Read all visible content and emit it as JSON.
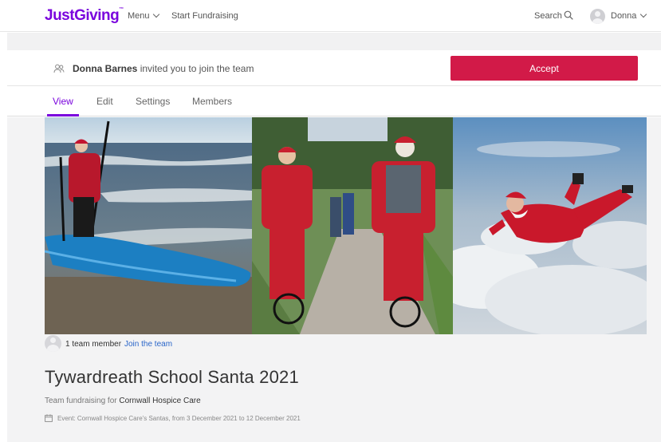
{
  "nav": {
    "logo": "JustGiving",
    "logo_mark": "™",
    "menu_label": "Menu",
    "start_fundraising": "Start Fundraising",
    "search_label": "Search",
    "user_name": "Donna"
  },
  "invite": {
    "inviter": "Donna Barnes",
    "message": " invited you to join the team",
    "accept_label": "Accept"
  },
  "tabs": [
    {
      "label": "View",
      "active": true
    },
    {
      "label": "Edit",
      "active": false
    },
    {
      "label": "Settings",
      "active": false
    },
    {
      "label": "Members",
      "active": false
    }
  ],
  "team": {
    "member_count": "1 team member",
    "join_link": "Join the team",
    "title": "Tywardreath School Santa 2021",
    "fund_prefix": "Team fundraising for ",
    "charity": "Cornwall Hospice Care",
    "event_text": "Event: Cornwall Hospice Care's Santas, from 3 December 2021 to 12 December 2021"
  },
  "colors": {
    "brand": "#7a04dd",
    "accept": "#d21a48",
    "link": "#2a66c9"
  }
}
